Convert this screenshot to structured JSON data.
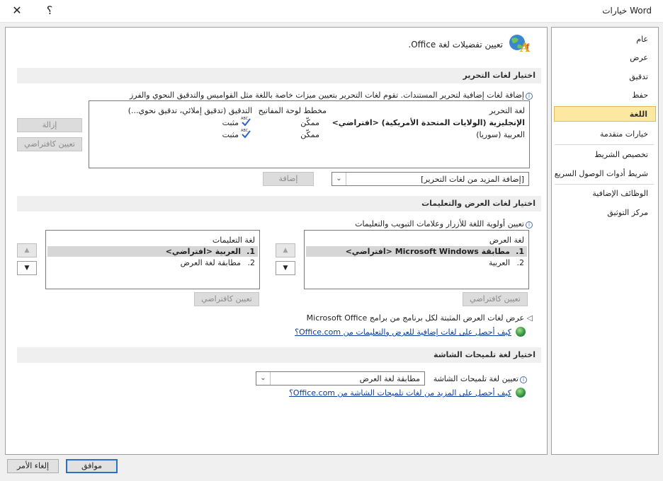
{
  "window": {
    "title": "خيارات Word",
    "help_label": "؟",
    "close_label": "✕"
  },
  "sidebar": {
    "items": [
      {
        "label": "عام"
      },
      {
        "label": "عرض"
      },
      {
        "label": "تدقيق"
      },
      {
        "label": "حفظ"
      },
      {
        "label": "اللغة"
      },
      {
        "label": "خيارات متقدمة"
      },
      {
        "label": "تخصيص الشريط"
      },
      {
        "label": "شريط أدوات الوصول السريع"
      },
      {
        "label": "الوظائف الإضافية"
      },
      {
        "label": "مركز التوثيق"
      }
    ],
    "selected": "اللغة"
  },
  "header": {
    "title": "تعيين تفضيلات لغة Office."
  },
  "editing": {
    "section_title": "اختيار لغات التحرير",
    "description": "إضافة لغات إضافية لتحرير المستندات. تقوم لغات التحرير بتعيين ميزات خاصة باللغة مثل القواميس والتدقيق النحوي والفرز",
    "columns": [
      "لغة التحرير",
      "مخطط لوحة المفاتيح",
      "التدقيق (تدقيق إملائي، تدقيق نحوي...)"
    ],
    "rows": [
      {
        "language": "الإنجليزية (الولايات المتحدة الأمريكية) <افتراضي>",
        "keyboard": "ممكّن",
        "proofing": "مثبت"
      },
      {
        "language": "العربية (سوريا)",
        "keyboard": "ممكّن",
        "proofing": "مثبت"
      }
    ],
    "remove_button": "إزالة",
    "set_default_button": "تعيين كافتراضي",
    "add_combo_value": "[إضافة المزيد من لغات التحرير]",
    "add_button": "إضافة"
  },
  "display": {
    "section_title": "اختيار لغات العرض والتعليمات",
    "description": "تعيين أولوية اللغة للأزرار وعلامات التبويب والتعليمات",
    "display_list": {
      "header": "لغة العرض",
      "items": [
        {
          "num": "1.",
          "label": "مطابقة Microsoft Windows <افتراضي>"
        },
        {
          "num": "2.",
          "label": "العربية"
        }
      ]
    },
    "help_list": {
      "header": "لغة التعليمات",
      "items": [
        {
          "num": "1.",
          "label": "العربية <افتراضي>"
        },
        {
          "num": "2.",
          "label": "مطابقة لغة العرض"
        }
      ]
    },
    "set_default_display": "تعيين كافتراضي",
    "set_default_help": "تعيين كافتراضي",
    "expand_text": "عرض لغات العرض المثبتة لكل برنامج من برامج Microsoft Office",
    "link": "كيف أحصل على لغات إضافية للعرض والتعليمات من Office.com؟"
  },
  "screentip": {
    "section_title": "اختيار لغة تلميحات الشاشة",
    "label": "تعيين لغة تلميحات الشاشة",
    "combo_value": "مطابقة لغة العرض",
    "link": "كيف أحصل على المزيد من لغات تلميحات الشاشة من Office.com؟"
  },
  "footer": {
    "ok": "موافق",
    "cancel": "إلغاء الأمر"
  }
}
